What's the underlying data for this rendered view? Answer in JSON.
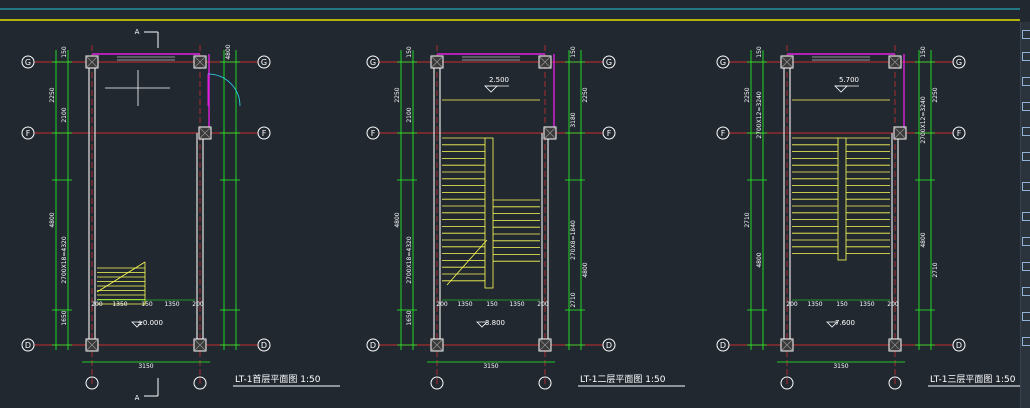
{
  "colors": {
    "background": "#212830",
    "topline_cyan": "#27c9d6",
    "topline_yellow": "#e2e200",
    "axis": "#ff3030",
    "dim": "#22ff22",
    "wall": "#c8c8c8",
    "stair": "#ffff55",
    "magenta": "#e020e0",
    "text": "#ffffff",
    "door": "#30e0ff"
  },
  "section_label": "A",
  "plans": [
    {
      "title": "LT-1首层平面图 1:50",
      "grids": {
        "top": "G",
        "mid": "F",
        "bot": "D"
      },
      "left_dims": [
        "150",
        "2250",
        "2100",
        "2700X18=4320",
        "4800",
        "1650"
      ],
      "right_dims": [
        "4800"
      ],
      "level": "±0.000",
      "bottom_dims": [
        "200",
        "1350",
        "150",
        "1350",
        "200"
      ],
      "width_dim": "3150"
    },
    {
      "title": "LT-1二层平面图 1:50",
      "grids": {
        "top": "G",
        "mid": "F",
        "bot": "D"
      },
      "left_dims": [
        "150",
        "2250",
        "2100",
        "2700X18=4320",
        "4800",
        "1650"
      ],
      "right_dims": [
        "150",
        "2250",
        "3180",
        "270X8=1840",
        "4800",
        "2710"
      ],
      "level_top": "2.500",
      "level": "3.800",
      "bottom_dims": [
        "200",
        "1350",
        "150",
        "1350",
        "200"
      ],
      "width_dim": "3150"
    },
    {
      "title": "LT-1三层平面图 1:50",
      "grids": {
        "top": "G",
        "mid": "F",
        "bot": "D"
      },
      "left_dims": [
        "150",
        "2250",
        "2700X12=3240",
        "4800",
        "2710"
      ],
      "right_dims": [
        "150",
        "2250",
        "2700X12=3240",
        "4800",
        "2710"
      ],
      "level_top": "5.700",
      "level": "7.600",
      "bottom_dims": [
        "200",
        "1350",
        "150",
        "1350",
        "200"
      ],
      "width_dim": "3150"
    }
  ]
}
